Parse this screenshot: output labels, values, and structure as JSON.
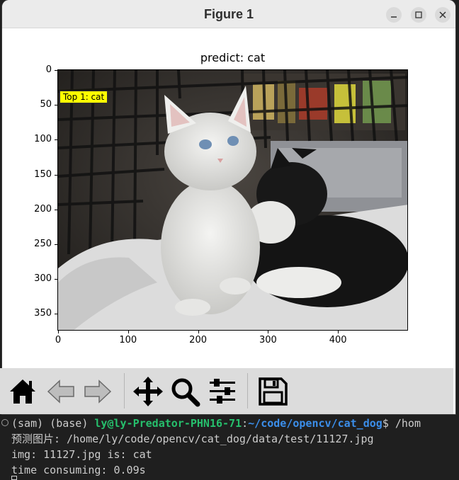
{
  "window": {
    "title": "Figure 1"
  },
  "figure": {
    "title": "predict: cat",
    "annotation": "Top 1: cat",
    "y_ticks": [
      "0",
      "50",
      "100",
      "150",
      "200",
      "250",
      "300",
      "350"
    ],
    "x_ticks": [
      "0",
      "100",
      "200",
      "300",
      "400"
    ]
  },
  "toolbar": {
    "items": [
      "home",
      "back",
      "forward",
      "pan",
      "zoom",
      "configure-subplots",
      "save"
    ]
  },
  "terminal": {
    "env": "(sam) (base) ",
    "user_host": "ly@ly-Predator-PHN16-71",
    "colon": ":",
    "path": "~/code/opencv/cat_dog",
    "dollar": "$ /hom",
    "line2": "预测图片: /home/ly/code/opencv/cat_dog/data/test/11127.jpg",
    "line3": "img: 11127.jpg is: cat",
    "line4": "time consuming: 0.09s"
  }
}
